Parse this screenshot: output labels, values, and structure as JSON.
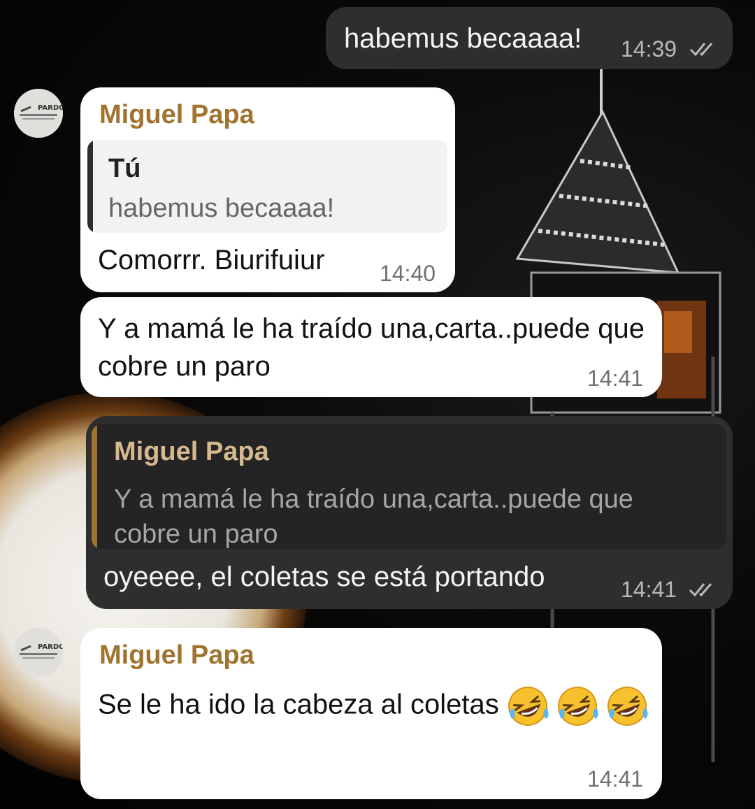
{
  "chat": {
    "messages": [
      {
        "text": "habemus becaaaa!",
        "time": "14:39",
        "read_icon": "double-check-icon"
      },
      {
        "sender": "Miguel Papa",
        "avatar_label": "PARDO",
        "reply_to": {
          "name": "Tú",
          "text": "habemus becaaaa!"
        },
        "text": "Comorrr. Biurifuiur",
        "time": "14:40"
      },
      {
        "text": "Y a mamá le ha traído una,carta..puede que cobre un paro",
        "time": "14:41"
      },
      {
        "reply_to": {
          "name": "Miguel Papa",
          "text": "Y a mamá le ha traído una,carta..puede que cobre un paro"
        },
        "text": "oyeeee, el coletas se está portando",
        "time": "14:41",
        "read_icon": "double-check-icon"
      },
      {
        "sender": "Miguel Papa",
        "avatar_label": "PARDO",
        "text": "Se le ha ido la cabeza al coletas",
        "emoji_count": 3,
        "emoji_icon": "rolling-on-floor-laughing-icon",
        "time": "14:41"
      }
    ]
  },
  "colors": {
    "outgoing_bubble": "#2e2e2f",
    "incoming_bubble": "#ffffff",
    "sender_name": "#a0732f",
    "quote_bar_in": "#2e2e2f",
    "quote_bar_out": "#a0732f"
  }
}
